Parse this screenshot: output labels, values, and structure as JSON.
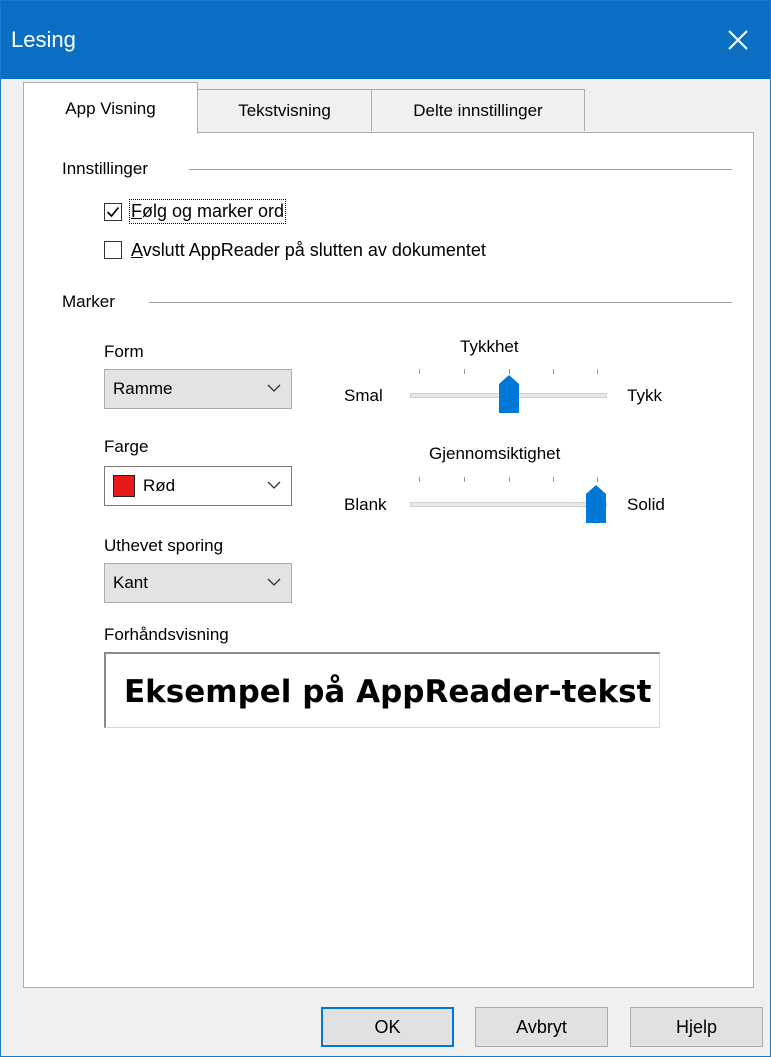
{
  "window": {
    "title": "Lesing"
  },
  "tabs": [
    {
      "label": "App Visning",
      "active": true
    },
    {
      "label": "Tekstvisning",
      "active": false
    },
    {
      "label": "Delte innstillinger",
      "active": false
    }
  ],
  "settings": {
    "group_label": "Innstillinger",
    "follow_highlight": {
      "accesskey": "F",
      "rest": "ølg og marker ord",
      "checked": true
    },
    "exit_at_end": {
      "accesskey": "A",
      "rest": "vslutt AppReader på slutten av dokumentet",
      "checked": false
    }
  },
  "marker": {
    "group_label": "Marker",
    "form": {
      "label": "Form",
      "value": "Ramme"
    },
    "color": {
      "label": "Farge",
      "value": "Rød",
      "swatch": "#e61a1a"
    },
    "tracking": {
      "label": "Uthevet sporing",
      "value": "Kant"
    },
    "thickness": {
      "label": "Tykkhet",
      "min_label": "Smal",
      "max_label": "Tykk",
      "value_fraction": 0.5
    },
    "opacity": {
      "label": "Gjennomsiktighet",
      "min_label": "Blank",
      "max_label": "Solid",
      "value_fraction": 1.0
    },
    "preview": {
      "label": "Forhåndsvisning",
      "sample_text": "Eksempel på AppReader-tekst"
    }
  },
  "buttons": {
    "ok": "OK",
    "cancel": "Avbryt",
    "help": "Hjelp"
  },
  "colors": {
    "titlebar": "#0a6fc2",
    "accent": "#0078d7"
  }
}
